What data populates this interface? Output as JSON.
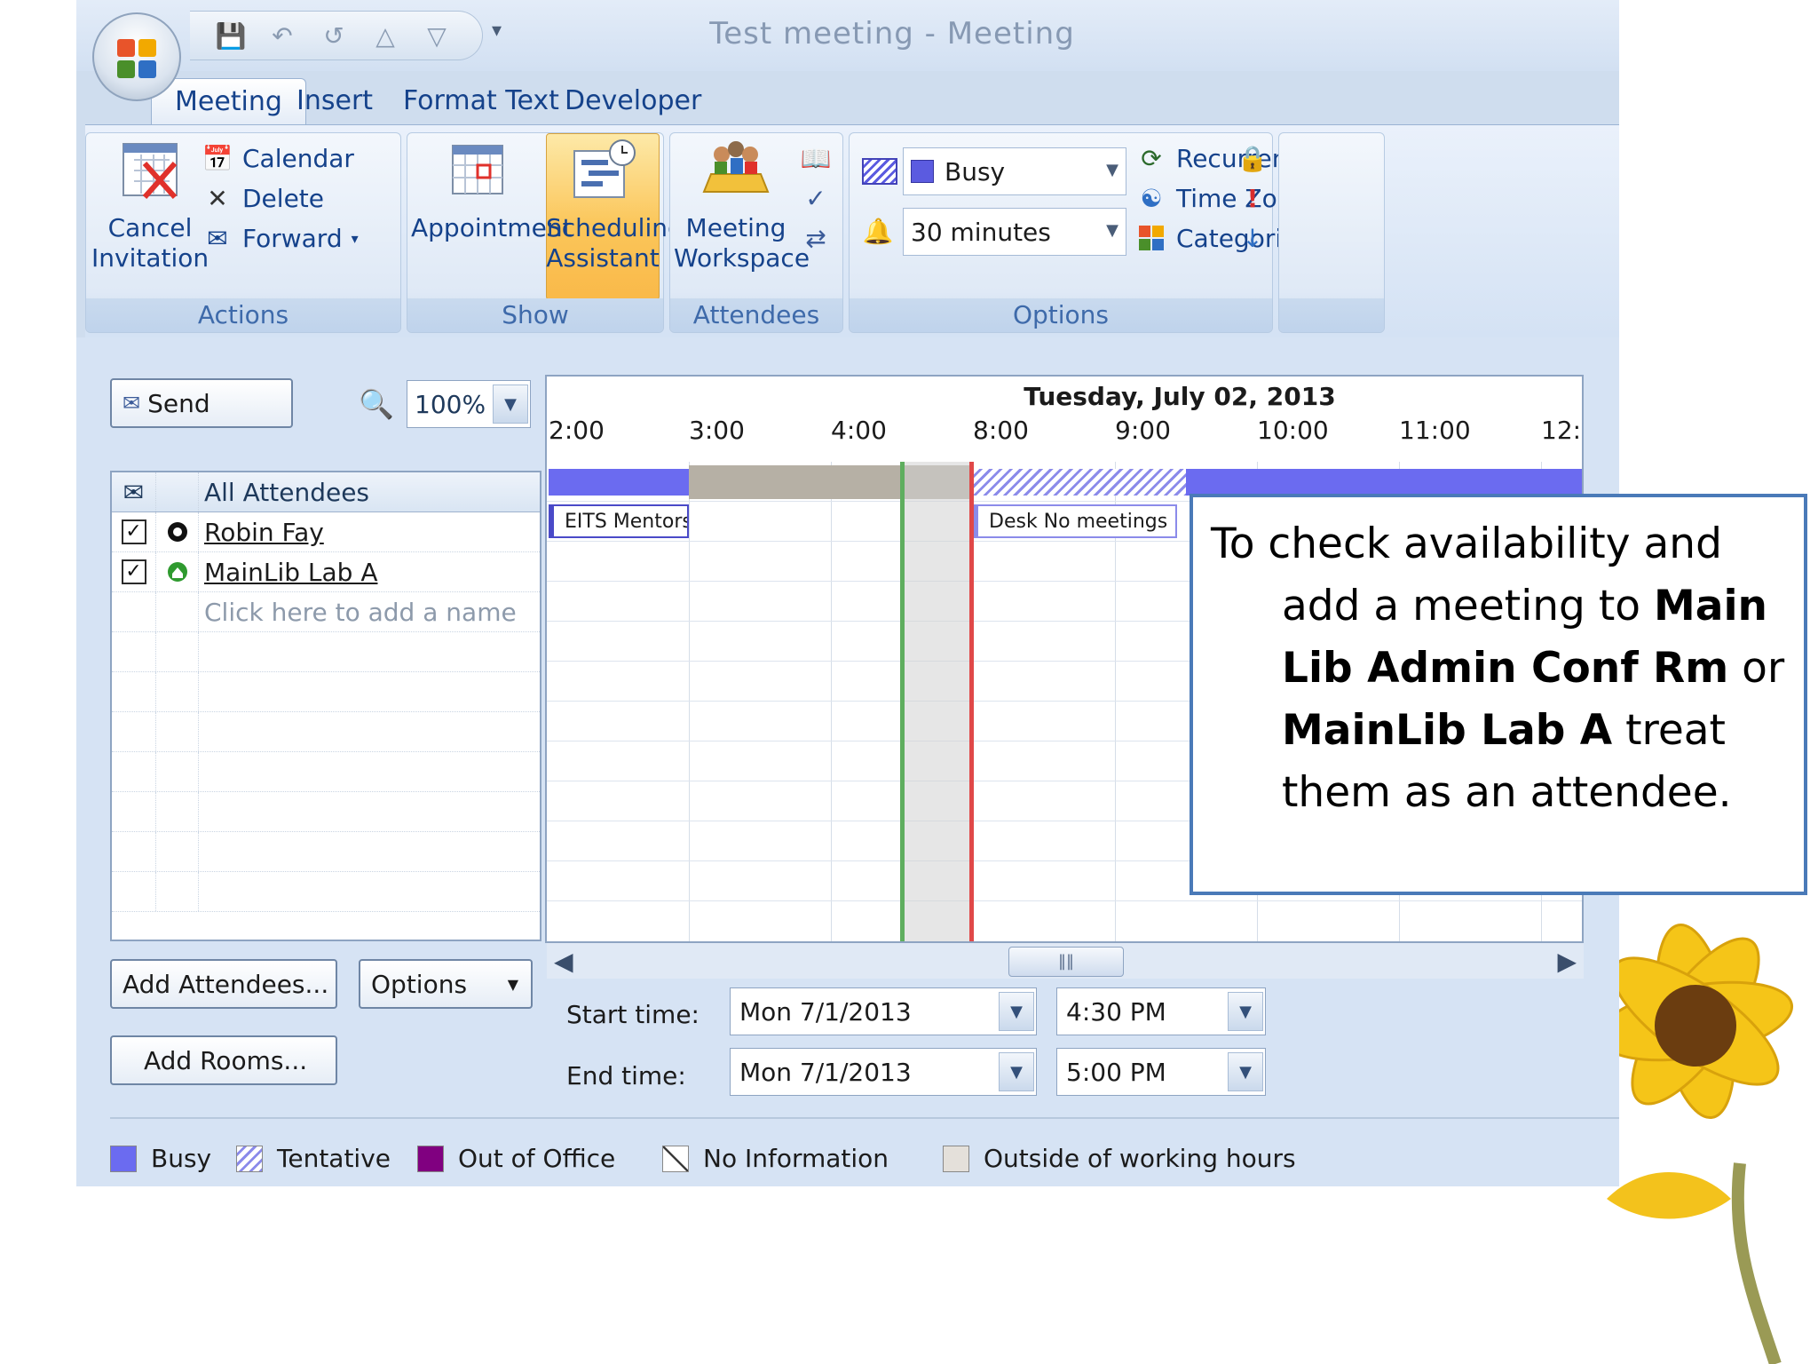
{
  "window": {
    "title": "Test meeting - Meeting"
  },
  "tabs": [
    "Meeting",
    "Insert",
    "Format Text",
    "Developer"
  ],
  "ribbon": {
    "actions": {
      "label": "Actions",
      "cancel_line1": "Cancel",
      "cancel_line2": "Invitation",
      "calendar": "Calendar",
      "delete": "Delete",
      "forward": "Forward"
    },
    "show": {
      "label": "Show",
      "appointment": "Appointment",
      "scheduling_line1": "Scheduling",
      "scheduling_line2": "Assistant"
    },
    "attendees": {
      "label": "Attendees",
      "workspace_line1": "Meeting",
      "workspace_line2": "Workspace"
    },
    "options": {
      "label": "Options",
      "show_as": "Busy",
      "reminder": "30 minutes",
      "recurrence": "Recurrence",
      "time_zones": "Time Zones",
      "categorize": "Categorize"
    }
  },
  "pane": {
    "send": "Send",
    "zoom": "100%",
    "header_all": "All Attendees",
    "attendees": [
      {
        "name": "Robin Fay",
        "checked": true,
        "type": "person"
      },
      {
        "name": "MainLib Lab A",
        "checked": true,
        "type": "resource"
      }
    ],
    "add_name_placeholder": "Click here to add a name",
    "add_attendees": "Add Attendees...",
    "options_btn": "Options",
    "add_rooms": "Add Rooms...",
    "start_label": "Start time:",
    "end_label": "End time:",
    "start_date": "Mon 7/1/2013",
    "start_time": "4:30 PM",
    "end_date": "Mon 7/1/2013",
    "end_time": "5:00 PM"
  },
  "schedule": {
    "date": "Tuesday, July 02, 2013",
    "hours": [
      "2:00",
      "3:00",
      "4:00",
      "8:00",
      "9:00",
      "10:00",
      "11:00",
      "12:"
    ],
    "appt_robin": "EITS Mentors",
    "appt_lab": "Desk No meetings"
  },
  "legend": {
    "busy": "Busy",
    "tentative": "Tentative",
    "out_of_office": "Out of Office",
    "no_info": "No Information",
    "outside_hours": "Outside of working hours"
  },
  "colors": {
    "busy": "#6b6bf0",
    "tentative": "#8b8bea",
    "out_of_office": "#800080",
    "start_line": "#5fae5f",
    "end_line": "#e04848"
  },
  "callout": {
    "t1": "To check availability and add a meeting to ",
    "b1": "Main Lib Admin Conf Rm",
    "t2": " or ",
    "b2": "MainLib Lab A",
    "t3": " treat them as an attendee."
  }
}
